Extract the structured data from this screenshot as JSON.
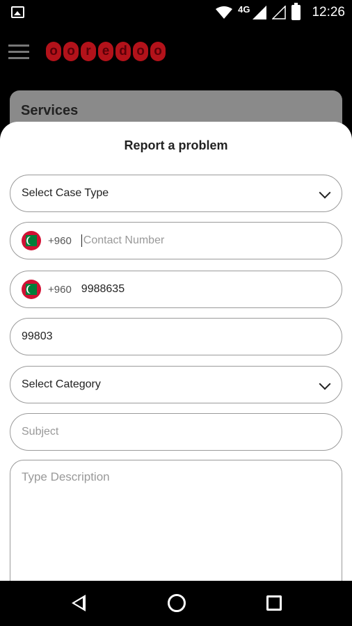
{
  "status_bar": {
    "network": "4G",
    "time": "12:26"
  },
  "app_bar": {
    "logo_text": "ooredoo"
  },
  "background": {
    "services_title": "Services"
  },
  "sheet": {
    "title": "Report a problem",
    "case_type": {
      "placeholder": "Select Case Type"
    },
    "contact_number": {
      "prefix": "+960",
      "placeholder": "Contact Number"
    },
    "account_number": {
      "prefix": "+960",
      "value": "9988635"
    },
    "code_field": {
      "value": "99803"
    },
    "category": {
      "placeholder": "Select Category"
    },
    "subject": {
      "placeholder": "Subject"
    },
    "description": {
      "placeholder": "Type Description"
    }
  },
  "colors": {
    "brand_red": "#b3121a",
    "flag_red": "#d21034",
    "flag_green": "#007e3a"
  }
}
